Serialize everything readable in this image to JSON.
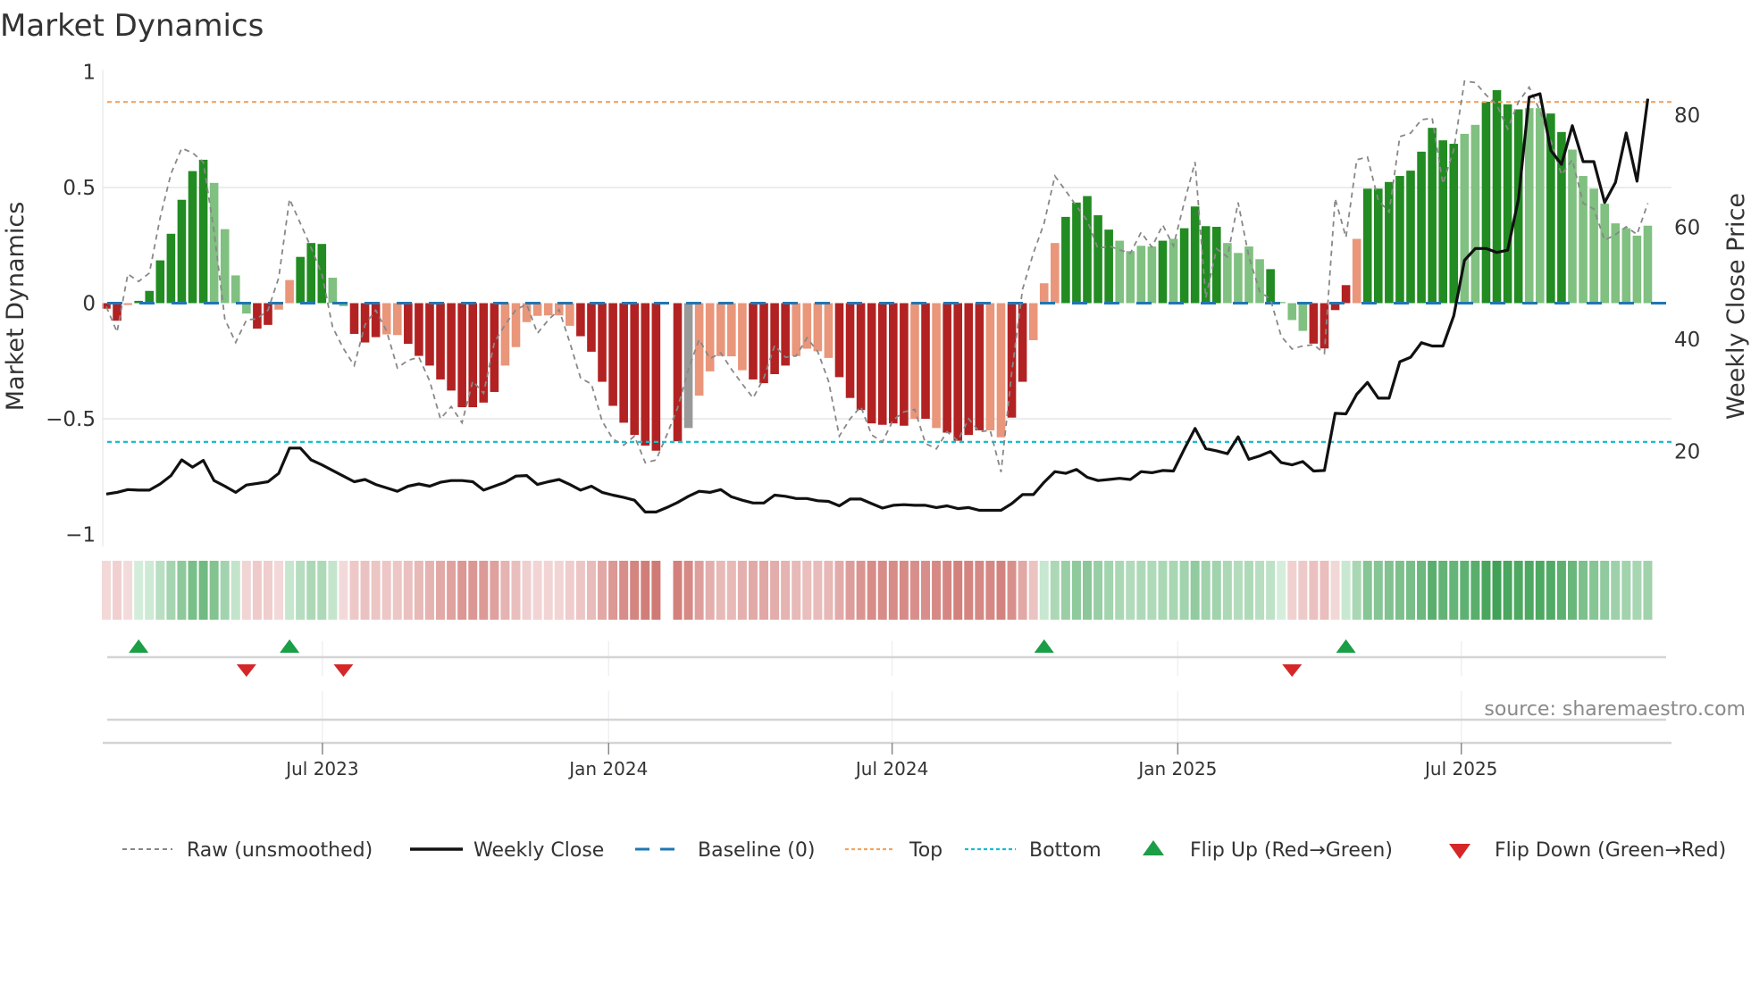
{
  "title": "Market Dynamics",
  "source": "source: sharemaestro.com",
  "colors": {
    "rise_green": "#228b22",
    "fade_green": "#80c080",
    "fall_red": "#b22222",
    "fade_red": "#e9967a",
    "raw": "#888888",
    "close": "#111111",
    "baseline": "#1f77b4",
    "top": "#f4a460",
    "bottom": "#17becf",
    "flip_up": "#1a9e46",
    "flip_down": "#d62728"
  },
  "legend": {
    "raw": "Raw (unsmoothed)",
    "close": "Weekly Close",
    "baseline": "Baseline (0)",
    "top": "Top",
    "bottom": "Bottom",
    "flip_up": "Flip Up (Red→Green)",
    "flip_down": "Flip Down (Green→Red)"
  },
  "chart_data": {
    "type": "bar",
    "title": "Market Dynamics",
    "ylabel": "Market Dynamics",
    "ylabel_right": "Weekly Close Price",
    "ylim": [
      -1,
      1
    ],
    "ylim_right": [
      5.2,
      87.7
    ],
    "xlim_weeks": [
      -0.33,
      145.2
    ],
    "y_ticks": [
      {
        "v": 1,
        "label": "1"
      },
      {
        "v": 0.5,
        "label": "0.5"
      },
      {
        "v": 0,
        "label": "0"
      },
      {
        "v": -0.5,
        "label": "−0.5"
      },
      {
        "v": -1,
        "label": "−1"
      }
    ],
    "y_ticks_right": [
      {
        "v": 80,
        "label": "80"
      },
      {
        "v": 60,
        "label": "60"
      },
      {
        "v": 40,
        "label": "40"
      },
      {
        "v": 20,
        "label": "20"
      }
    ],
    "x_ticks": [
      {
        "week": 20.05,
        "label": "Jul 2023"
      },
      {
        "week": 46.6,
        "label": "Jan 2024"
      },
      {
        "week": 72.9,
        "label": "Jul 2024"
      },
      {
        "week": 99.4,
        "label": "Jan 2025"
      },
      {
        "week": 125.7,
        "label": "Jul 2025"
      }
    ],
    "grid": true,
    "legend_position": "bottom",
    "top_level": 0.87,
    "bottom_level": -0.6,
    "baseline": 0,
    "smoothed": [
      -0.024,
      -0.076,
      -0.008,
      0.01,
      0.053,
      0.185,
      0.3,
      0.447,
      0.571,
      0.62,
      0.52,
      0.32,
      0.12,
      -0.045,
      -0.11,
      -0.094,
      -0.028,
      0.1,
      0.2,
      0.26,
      0.256,
      0.11,
      -0.013,
      -0.133,
      -0.17,
      -0.147,
      -0.135,
      -0.138,
      -0.176,
      -0.228,
      -0.27,
      -0.33,
      -0.378,
      -0.45,
      -0.45,
      -0.43,
      -0.384,
      -0.27,
      -0.19,
      -0.082,
      -0.055,
      -0.053,
      -0.053,
      -0.098,
      -0.143,
      -0.21,
      -0.34,
      -0.444,
      -0.517,
      -0.57,
      -0.616,
      -0.638,
      null,
      -0.597,
      -0.54,
      -0.4,
      -0.295,
      -0.229,
      -0.23,
      -0.29,
      -0.33,
      -0.346,
      -0.307,
      -0.27,
      -0.229,
      -0.197,
      -0.208,
      -0.237,
      -0.32,
      -0.41,
      -0.462,
      -0.52,
      -0.526,
      -0.52,
      -0.53,
      -0.5,
      -0.5,
      -0.54,
      -0.56,
      -0.595,
      -0.57,
      -0.55,
      -0.55,
      -0.58,
      -0.495,
      -0.34,
      -0.16,
      0.086,
      0.26,
      0.373,
      0.435,
      0.463,
      0.38,
      0.318,
      0.27,
      0.225,
      0.248,
      0.245,
      0.27,
      0.278,
      0.324,
      0.418,
      0.333,
      0.33,
      0.26,
      0.217,
      0.245,
      0.19,
      0.147,
      0.005,
      -0.073,
      -0.12,
      -0.175,
      -0.196,
      -0.03,
      0.078,
      0.278,
      0.495,
      0.495,
      0.524,
      0.55,
      0.573,
      0.655,
      0.758,
      0.704,
      0.689,
      0.732,
      0.771,
      0.871,
      0.921,
      0.86,
      0.838,
      0.843,
      0.843,
      0.82,
      0.74,
      0.664,
      0.55,
      0.495,
      0.43,
      0.345,
      0.324,
      0.292,
      0.335
    ],
    "tones": "rrsgggggggllllrrssgggllrrrssrrrrrrrrrsssssssrrrrrrrrrrxsssssrrrrssssrrrrrrrsrsrrrrssrrsssgggggllllglggggllllglllrrrrsgggggggggllggggllggllllllllg",
    "raw": [
      -0.015,
      -0.125,
      0.126,
      0.094,
      0.13,
      0.37,
      0.56,
      0.67,
      0.65,
      0.61,
      0.31,
      -0.07,
      -0.17,
      -0.073,
      -0.067,
      -0.03,
      0.11,
      0.45,
      0.345,
      0.24,
      0.126,
      -0.105,
      -0.196,
      -0.27,
      -0.093,
      -0.03,
      -0.12,
      -0.28,
      -0.247,
      -0.234,
      -0.337,
      -0.5,
      -0.447,
      -0.517,
      -0.337,
      -0.39,
      -0.17,
      -0.093,
      -0.028,
      -0.005,
      -0.13,
      -0.073,
      -0.028,
      -0.17,
      -0.324,
      -0.35,
      -0.51,
      -0.588,
      -0.614,
      -0.575,
      -0.69,
      -0.678,
      -0.57,
      -0.453,
      -0.286,
      -0.157,
      -0.24,
      -0.215,
      -0.286,
      -0.35,
      -0.41,
      -0.324,
      -0.183,
      -0.234,
      -0.228,
      -0.15,
      -0.21,
      -0.337,
      -0.575,
      -0.5,
      -0.447,
      -0.57,
      -0.6,
      -0.505,
      -0.47,
      -0.46,
      -0.607,
      -0.63,
      -0.556,
      -0.595,
      -0.5,
      -0.556,
      -0.55,
      -0.73,
      -0.3,
      0.06,
      0.216,
      0.345,
      0.55,
      0.486,
      0.42,
      0.357,
      0.235,
      0.248,
      0.23,
      0.216,
      0.306,
      0.242,
      0.338,
      0.248,
      0.435,
      0.61,
      0.023,
      0.235,
      0.2,
      0.435,
      0.2,
      0.05,
      0.017,
      -0.144,
      -0.198,
      -0.185,
      -0.18,
      -0.217,
      0.452,
      0.285,
      0.62,
      0.632,
      0.445,
      0.394,
      0.72,
      0.735,
      0.793,
      0.8,
      0.516,
      0.664,
      0.96,
      0.954,
      0.9,
      0.857,
      0.754,
      0.87,
      0.934,
      0.831,
      0.703,
      0.555,
      0.62,
      0.432,
      0.407,
      0.272,
      0.297,
      0.33,
      0.297,
      0.432
    ],
    "weekly_close": [
      12.4,
      12.7,
      13.2,
      13.1,
      13.1,
      14.2,
      15.7,
      18.5,
      17.2,
      18.4,
      14.8,
      13.8,
      12.7,
      14.0,
      14.3,
      14.6,
      16.1,
      20.6,
      20.6,
      18.5,
      17.6,
      16.6,
      15.6,
      14.6,
      15.0,
      14.1,
      13.5,
      12.9,
      13.8,
      14.2,
      13.8,
      14.5,
      14.8,
      14.8,
      14.6,
      13.1,
      13.8,
      14.5,
      15.6,
      15.7,
      14.1,
      14.6,
      15.0,
      14.1,
      13.1,
      13.8,
      12.7,
      12.2,
      11.8,
      11.3,
      9.2,
      9.2,
      10.0,
      10.9,
      12.0,
      12.9,
      12.7,
      13.2,
      11.9,
      11.3,
      10.8,
      10.8,
      12.2,
      12.0,
      11.6,
      11.6,
      11.2,
      11.1,
      10.3,
      11.5,
      11.5,
      10.7,
      9.9,
      10.4,
      10.5,
      10.4,
      10.4,
      10.0,
      10.3,
      9.8,
      10.0,
      9.5,
      9.5,
      9.5,
      10.7,
      12.3,
      12.3,
      14.5,
      16.4,
      16.1,
      16.8,
      15.4,
      14.8,
      15.0,
      15.2,
      15.0,
      16.4,
      16.2,
      16.6,
      16.5,
      20.4,
      24.1,
      20.5,
      20.1,
      19.6,
      22.6,
      18.6,
      19.2,
      20.0,
      18.0,
      17.6,
      18.2,
      16.5,
      16.6,
      26.8,
      26.7,
      30.2,
      32.3,
      29.5,
      29.5,
      36.0,
      36.8,
      39.4,
      38.8,
      38.8,
      44.2,
      54.1,
      56.2,
      56.2,
      55.5,
      55.9,
      65.0,
      83.2,
      83.8,
      73.7,
      71.2,
      78.1,
      71.7,
      71.7,
      64.4,
      68.0,
      76.8,
      68.2,
      82.9
    ],
    "flip_up_weeks": [
      3,
      17,
      87,
      115
    ],
    "flip_down_weeks": [
      13,
      22,
      110
    ]
  }
}
